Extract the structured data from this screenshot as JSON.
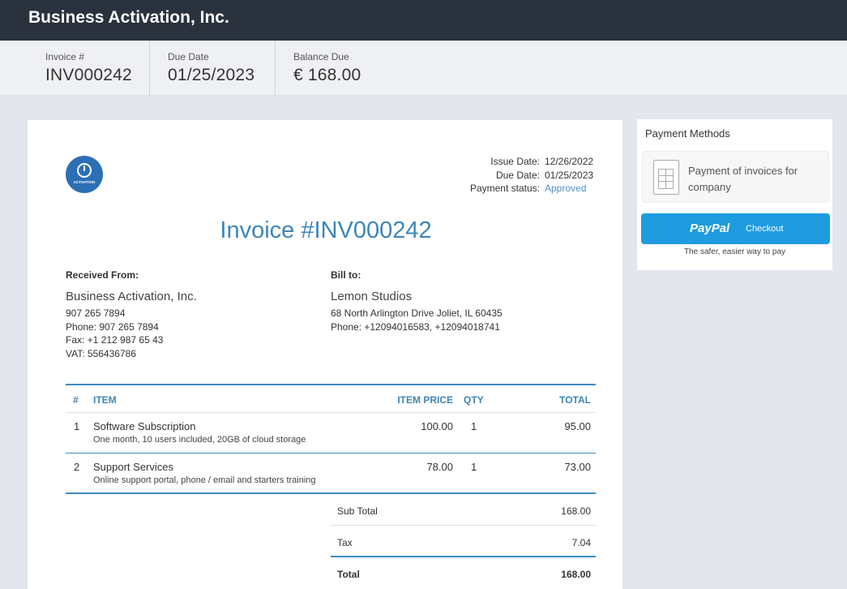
{
  "app": {
    "title": "Business Activation, Inc."
  },
  "summary": {
    "invoice_label": "Invoice #",
    "invoice_value": "INV000242",
    "due_label": "Due Date",
    "due_value": "01/25/2023",
    "balance_label": "Balance Due",
    "balance_value": "€ 168.00"
  },
  "invoice": {
    "logo_text": "ACTIVATION",
    "issue_label": "Issue Date:",
    "issue_value": "12/26/2022",
    "due_label": "Due Date:",
    "due_value": "01/25/2023",
    "status_label": "Payment status:",
    "status_value": "Approved",
    "title": "Invoice #INV000242",
    "from": {
      "heading": "Received From:",
      "name": "Business Activation, Inc.",
      "lines": [
        "907 265 7894",
        "Phone: 907 265 7894",
        "Fax: +1 212 987 65 43",
        "VAT: 556436786"
      ]
    },
    "to": {
      "heading": "Bill to:",
      "name": "Lemon Studios",
      "lines": [
        "68 North Arlington Drive Joliet, IL 60435",
        "Phone: +12094016583, +12094018741"
      ]
    },
    "columns": {
      "num": "#",
      "item": "ITEM",
      "price": "ITEM PRICE",
      "qty": "QTY",
      "total": "TOTAL"
    },
    "items": [
      {
        "num": "1",
        "name": "Software Subscription",
        "desc": "One month, 10 users included, 20GB of cloud storage",
        "price": "100.00",
        "qty": "1",
        "total": "95.00"
      },
      {
        "num": "2",
        "name": "Support Services",
        "desc": "Online support portal, phone / email and starters training",
        "price": "78.00",
        "qty": "1",
        "total": "73.00"
      }
    ],
    "totals": {
      "sub_label": "Sub Total",
      "sub_value": "168.00",
      "tax_label": "Tax",
      "tax_value": "7.04",
      "total_label": "Total",
      "total_value": "168.00"
    }
  },
  "payment": {
    "title": "Payment Methods",
    "method_label": "Payment of invoices for company",
    "paypal_logo": "PayPal",
    "paypal_checkout": "Checkout",
    "paypal_tagline": "The safer, easier way to pay"
  }
}
